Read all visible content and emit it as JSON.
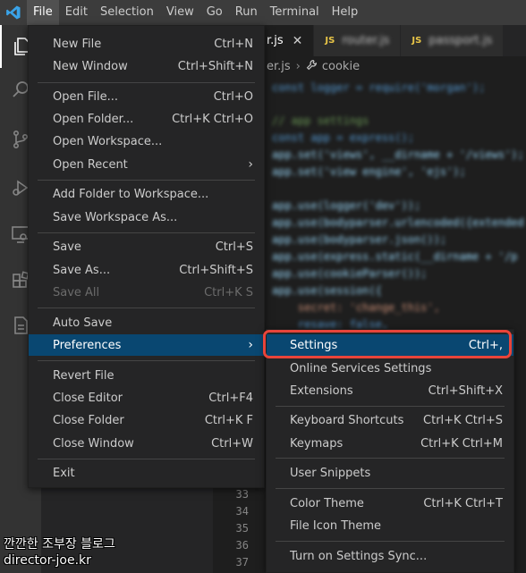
{
  "menubar": {
    "items": [
      "File",
      "Edit",
      "Selection",
      "View",
      "Go",
      "Run",
      "Terminal",
      "Help"
    ]
  },
  "activity_bar": {
    "icons": [
      "explorer-icon",
      "search-icon",
      "source-control-icon",
      "run-debug-icon",
      "remote-explorer-icon",
      "extensions-icon",
      "docker-icon"
    ]
  },
  "tabs": [
    {
      "label": "r.js",
      "active": true
    },
    {
      "label": "router.js",
      "active": false
    },
    {
      "label": "passport.js",
      "active": false
    }
  ],
  "breadcrumbs": {
    "file": "er.js",
    "symbol": "cookie"
  },
  "line_numbers": [
    "33",
    "34",
    "35",
    "36",
    "37"
  ],
  "file_menu": {
    "new_file": {
      "label": "New File",
      "shortcut": "Ctrl+N"
    },
    "new_window": {
      "label": "New Window",
      "shortcut": "Ctrl+Shift+N"
    },
    "open_file": {
      "label": "Open File...",
      "shortcut": "Ctrl+O"
    },
    "open_folder": {
      "label": "Open Folder...",
      "shortcut": "Ctrl+K Ctrl+O"
    },
    "open_workspace": {
      "label": "Open Workspace..."
    },
    "open_recent": {
      "label": "Open Recent"
    },
    "add_folder": {
      "label": "Add Folder to Workspace..."
    },
    "save_workspace_as": {
      "label": "Save Workspace As..."
    },
    "save": {
      "label": "Save",
      "shortcut": "Ctrl+S"
    },
    "save_as": {
      "label": "Save As...",
      "shortcut": "Ctrl+Shift+S"
    },
    "save_all": {
      "label": "Save All",
      "shortcut": "Ctrl+K S"
    },
    "auto_save": {
      "label": "Auto Save"
    },
    "preferences": {
      "label": "Preferences"
    },
    "revert_file": {
      "label": "Revert File"
    },
    "close_editor": {
      "label": "Close Editor",
      "shortcut": "Ctrl+F4"
    },
    "close_folder": {
      "label": "Close Folder",
      "shortcut": "Ctrl+K F"
    },
    "close_window": {
      "label": "Close Window",
      "shortcut": "Ctrl+W"
    },
    "exit": {
      "label": "Exit"
    }
  },
  "preferences_menu": {
    "settings": {
      "label": "Settings",
      "shortcut": "Ctrl+,"
    },
    "online_services": {
      "label": "Online Services Settings"
    },
    "extensions": {
      "label": "Extensions",
      "shortcut": "Ctrl+Shift+X"
    },
    "keyboard_shortcuts": {
      "label": "Keyboard Shortcuts",
      "shortcut": "Ctrl+K Ctrl+S"
    },
    "keymaps": {
      "label": "Keymaps",
      "shortcut": "Ctrl+K Ctrl+M"
    },
    "user_snippets": {
      "label": "User Snippets"
    },
    "color_theme": {
      "label": "Color Theme",
      "shortcut": "Ctrl+K Ctrl+T"
    },
    "file_icon_theme": {
      "label": "File Icon Theme"
    },
    "settings_sync": {
      "label": "Turn on Settings Sync..."
    }
  },
  "watermark": {
    "line1": "깐깐한 조부장 블로그",
    "line2": "director-joe.kr"
  },
  "colors": {
    "accent": "#094771",
    "highlight_box": "#e8443a",
    "menubar": "#3c3c3c"
  }
}
